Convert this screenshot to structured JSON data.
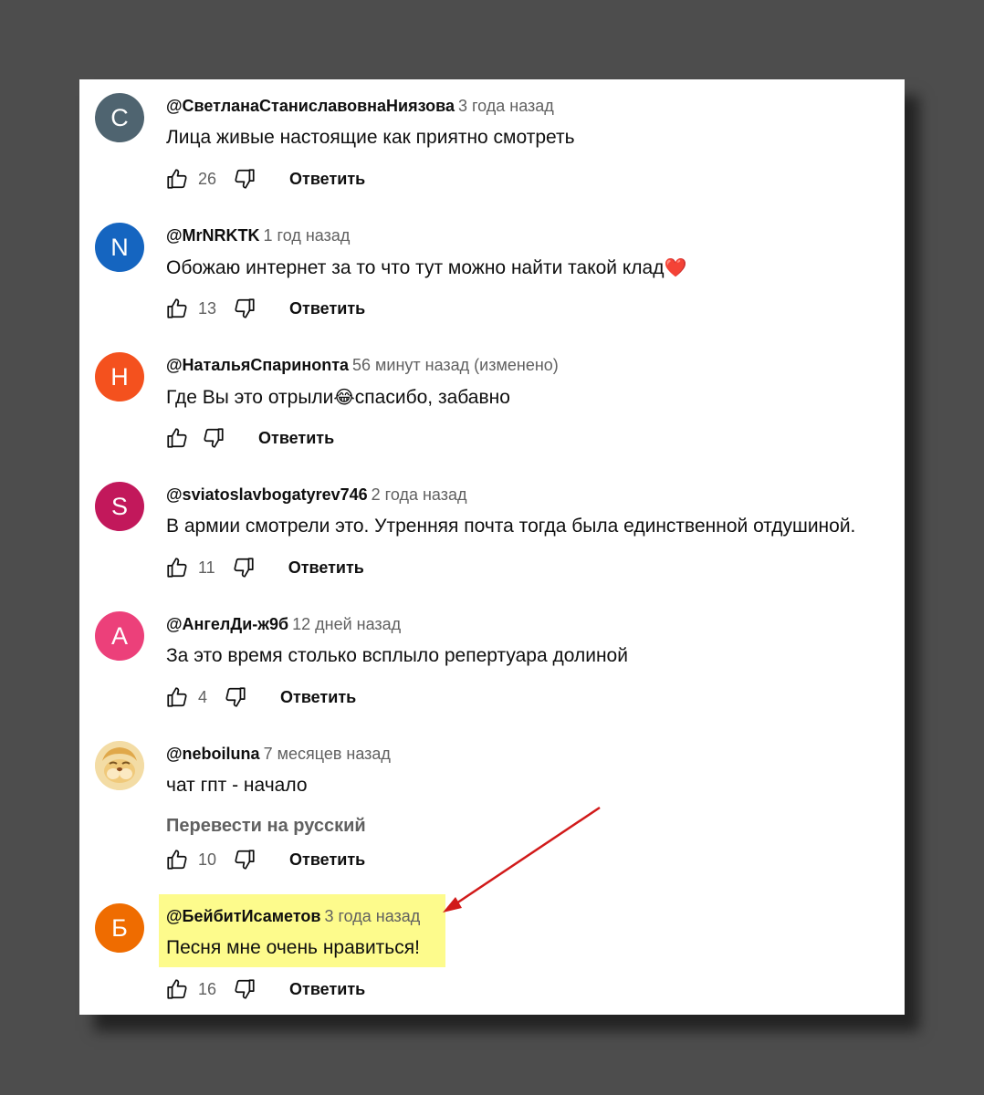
{
  "comments": [
    {
      "initial": "С",
      "author": "@СветланаСтаниславовнаНиязова",
      "time": "3 года назад",
      "text": "Лица живые настоящие как приятно смотреть",
      "likes": "26",
      "avatar_color": "#4f6470"
    },
    {
      "initial": "N",
      "author": "@MrNRKTK",
      "time": "1 год назад",
      "text": "Обожаю интернет за то что тут можно найти такой клад",
      "emoji": "❤️",
      "likes": "13",
      "avatar_color": "#1565c0"
    },
    {
      "initial": "Н",
      "author": "@НатальяСпариноnта",
      "time": "56 минут назад (изменено)",
      "text_before": "Где Вы это отрыли",
      "emoji": "😂",
      "text_after": "спасибо, забавно",
      "likes": "",
      "avatar_color": "#f4511e"
    },
    {
      "initial": "S",
      "author": "@sviatoslavbogatyrev746",
      "time": "2 года назад",
      "text": "В армии смотрели это. Утренняя почта тогда была единственной отдушиной.",
      "likes": "11",
      "avatar_color": "#c2185b"
    },
    {
      "initial": "А",
      "author": "@АнгелДи-ж9б",
      "time": "12 дней назад",
      "text": "За это время столько всплыло репертуара долиной",
      "likes": "4",
      "avatar_color": "#ec407a"
    },
    {
      "initial": "",
      "author": "@neboiluna",
      "time": "7 месяцев назад",
      "text": "чат гпт - начало",
      "translate": "Перевести на русский",
      "likes": "10",
      "avatar_color": "#e8c57a"
    },
    {
      "initial": "Б",
      "author": "@БейбитИсаметов",
      "time": "3 года назад",
      "text": "Песня мне очень нравиться!",
      "likes": "16",
      "avatar_color": "#ef6c00"
    }
  ],
  "reply_label": "Ответить",
  "highlight_color": "#fdfb8c",
  "arrow_color": "#d11a1a"
}
